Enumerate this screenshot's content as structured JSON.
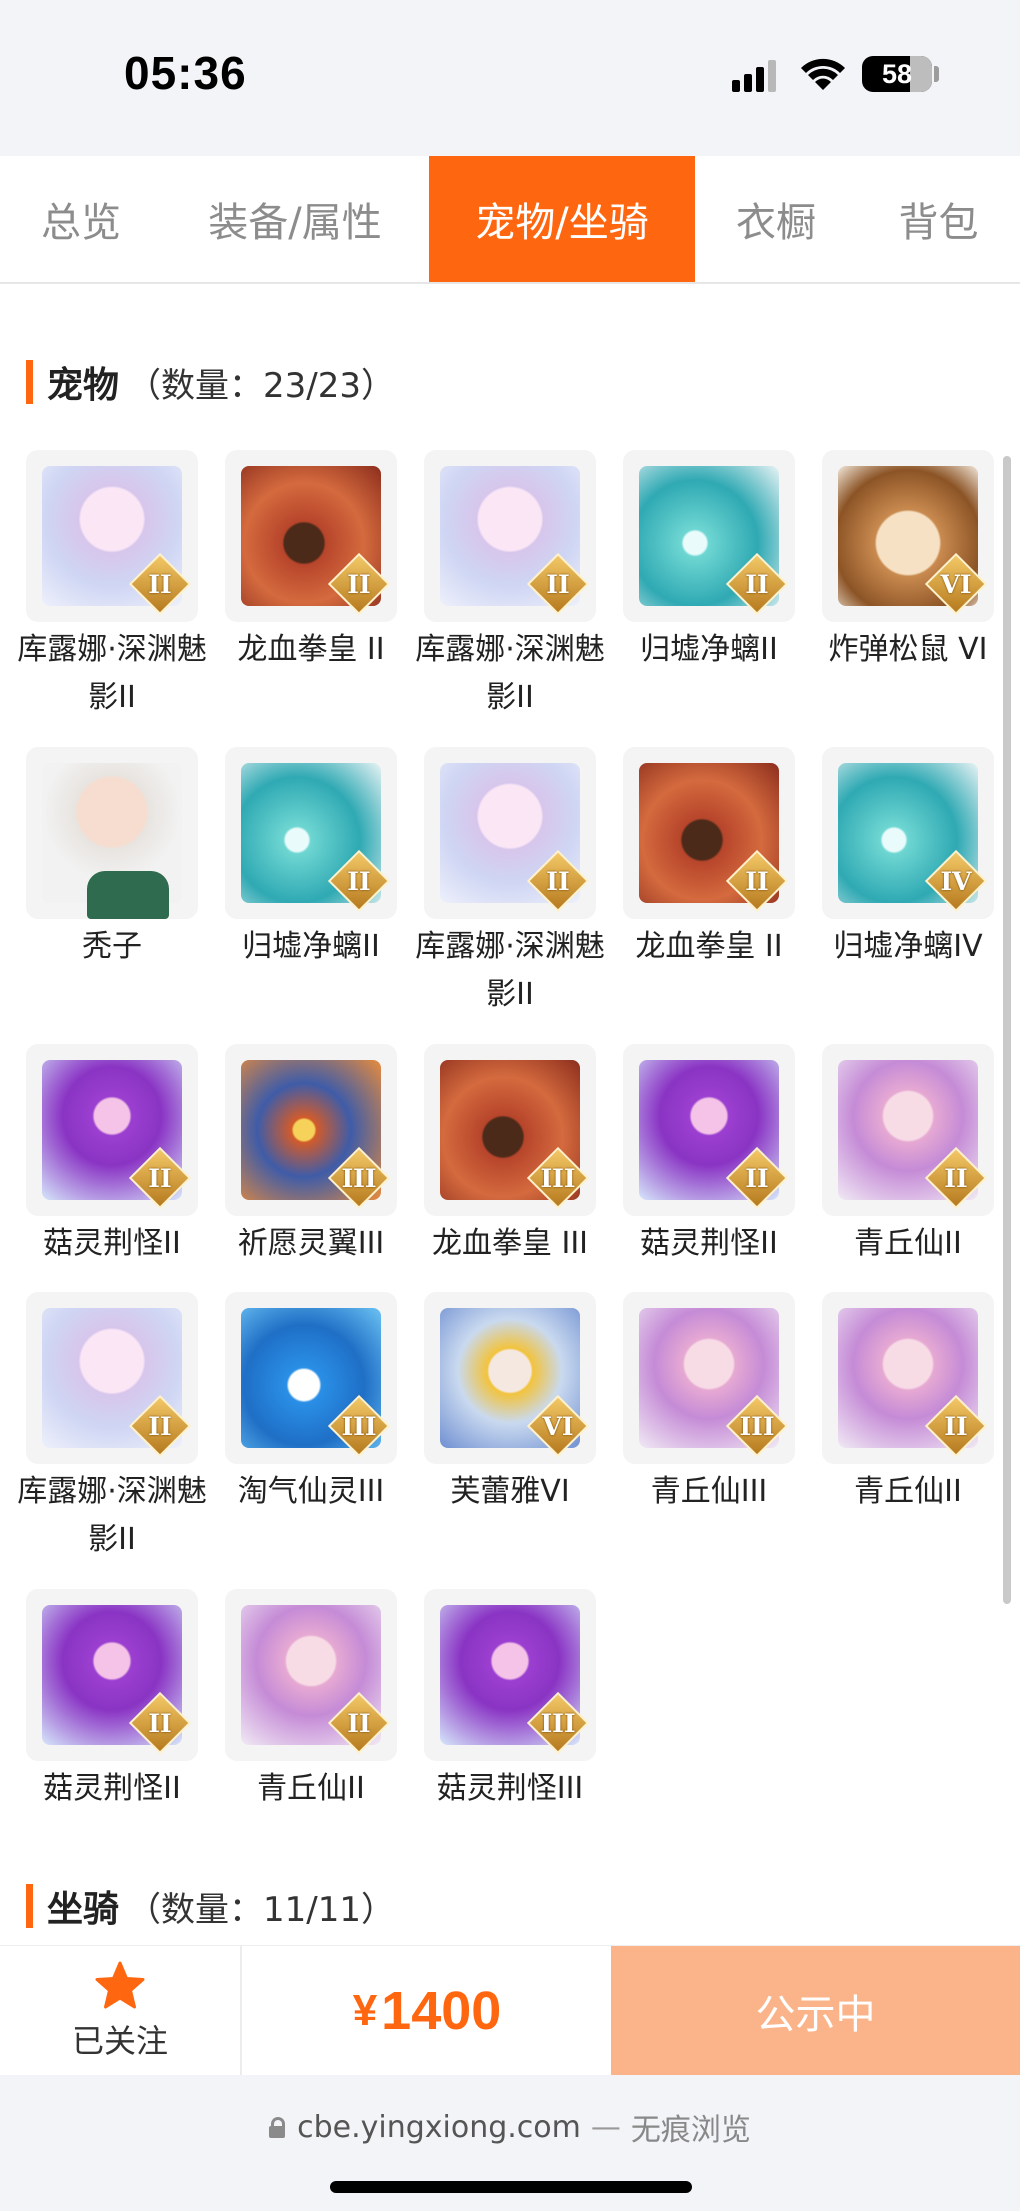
{
  "status_bar": {
    "time": "05:36",
    "battery": "58",
    "icons": [
      "signal-icon",
      "wifi-icon",
      "battery-icon"
    ]
  },
  "tabs": [
    {
      "label": "总览",
      "active": false
    },
    {
      "label": "装备/属性",
      "active": false
    },
    {
      "label": "宠物/坐骑",
      "active": true
    },
    {
      "label": "衣橱",
      "active": false
    },
    {
      "label": "背包",
      "active": false
    }
  ],
  "pets_section": {
    "title": "宠物",
    "count": "（数量：23/23）",
    "items": [
      {
        "name": "库露娜·深渊魅影II",
        "rank": "II",
        "art": "spirit"
      },
      {
        "name": "龙血拳皇 II",
        "rank": "II",
        "art": "dragon"
      },
      {
        "name": "库露娜·深渊魅影II",
        "rank": "II",
        "art": "spirit"
      },
      {
        "name": "归墟净螭II",
        "rank": "II",
        "art": "sea"
      },
      {
        "name": "炸弹松鼠 VI",
        "rank": "VI",
        "art": "squirrel"
      },
      {
        "name": "秃子",
        "rank": "",
        "art": "bald"
      },
      {
        "name": "归墟净螭II",
        "rank": "II",
        "art": "sea"
      },
      {
        "name": "库露娜·深渊魅影II",
        "rank": "II",
        "art": "spirit"
      },
      {
        "name": "龙血拳皇 II",
        "rank": "II",
        "art": "dragon"
      },
      {
        "name": "归墟净螭IV",
        "rank": "IV",
        "art": "sea"
      },
      {
        "name": "菇灵荆怪II",
        "rank": "II",
        "art": "mushroom"
      },
      {
        "name": "祈愿灵翼III",
        "rank": "III",
        "art": "bird"
      },
      {
        "name": "龙血拳皇 III",
        "rank": "III",
        "art": "dragon"
      },
      {
        "name": "菇灵荆怪II",
        "rank": "II",
        "art": "mushroom"
      },
      {
        "name": "青丘仙II",
        "rank": "II",
        "art": "fox"
      },
      {
        "name": "库露娜·深渊魅影II",
        "rank": "II",
        "art": "spirit"
      },
      {
        "name": "淘气仙灵III",
        "rank": "III",
        "art": "dog"
      },
      {
        "name": "芙蕾雅VI",
        "rank": "VI",
        "art": "queen"
      },
      {
        "name": "青丘仙III",
        "rank": "III",
        "art": "fox"
      },
      {
        "name": "青丘仙II",
        "rank": "II",
        "art": "fox"
      },
      {
        "name": "菇灵荆怪II",
        "rank": "II",
        "art": "mushroom"
      },
      {
        "name": "青丘仙II",
        "rank": "II",
        "art": "fox"
      },
      {
        "name": "菇灵荆怪III",
        "rank": "III",
        "art": "mushroom"
      }
    ]
  },
  "mounts_section": {
    "title": "坐骑",
    "count": "（数量：11/11）"
  },
  "bottom_bar": {
    "follow_label": "已关注",
    "price_symbol": "¥",
    "price": "1400",
    "status_label": "公示中"
  },
  "browser": {
    "host": "cbe.yingxiong.com",
    "separator": "—",
    "mode": "无痕浏览"
  },
  "colors": {
    "accent": "#ff6610",
    "status_button": "#fbb489"
  }
}
